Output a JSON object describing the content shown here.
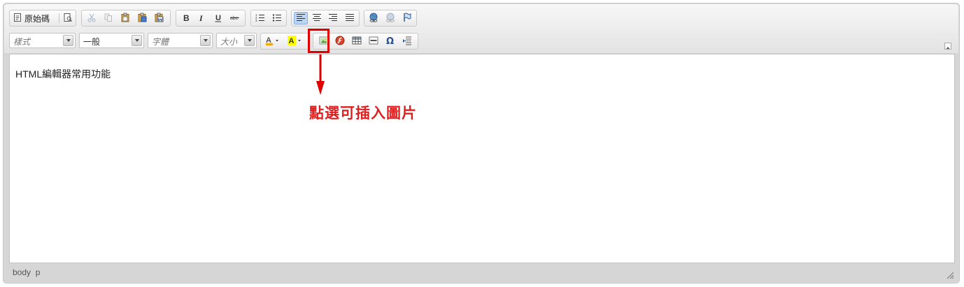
{
  "toolbar": {
    "row1": {
      "source_label": "原始碼"
    },
    "row2": {
      "combos": [
        {
          "name": "styles-combo",
          "label": "樣式"
        },
        {
          "name": "format-combo",
          "label": "一般"
        },
        {
          "name": "font-combo",
          "label": "字體"
        },
        {
          "name": "size-combo",
          "label": "大小"
        }
      ]
    }
  },
  "editor": {
    "content_text": "HTML編輯器常用功能"
  },
  "annotation": {
    "text": "點選可插入圖片",
    "color": "#e02020"
  },
  "statusbar": {
    "path": "body  p"
  },
  "colors": {
    "highlight_border": "#e00000",
    "active_button": "#bcd5f2"
  }
}
